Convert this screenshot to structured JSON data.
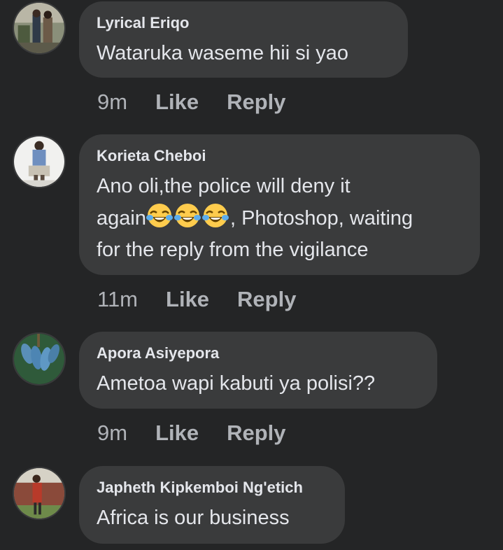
{
  "comments": [
    {
      "author": "Lyrical Eriqo",
      "text": "Wataruka waseme hii si yao",
      "time": "9m",
      "like_label": "Like",
      "reply_label": "Reply",
      "avatar_icon": "profile-photo"
    },
    {
      "author": "Korieta Cheboi",
      "text_line1": "Ano oli,the police will deny it",
      "text_line2_start": "again",
      "text_line2_end": ", Photoshop, waiting",
      "text_line3": "for the reply from the vigilance",
      "emoji_icon": "face-with-tears-of-joy-icon",
      "time": "11m",
      "like_label": "Like",
      "reply_label": "Reply",
      "avatar_icon": "profile-photo"
    },
    {
      "author": "Apora Asiyepora",
      "text": "Ametoa wapi kabuti ya polisi??",
      "time": "9m",
      "like_label": "Like",
      "reply_label": "Reply",
      "avatar_icon": "profile-photo"
    },
    {
      "author": "Japheth Kipkemboi Ng'etich",
      "text": "Africa is our business",
      "avatar_icon": "profile-photo"
    }
  ],
  "colors": {
    "background": "#242526",
    "bubble": "#3a3b3c",
    "primary_text": "#e4e6eb",
    "secondary_text": "#b0b3b8",
    "emoji_yellow": "#ffcc4d"
  }
}
